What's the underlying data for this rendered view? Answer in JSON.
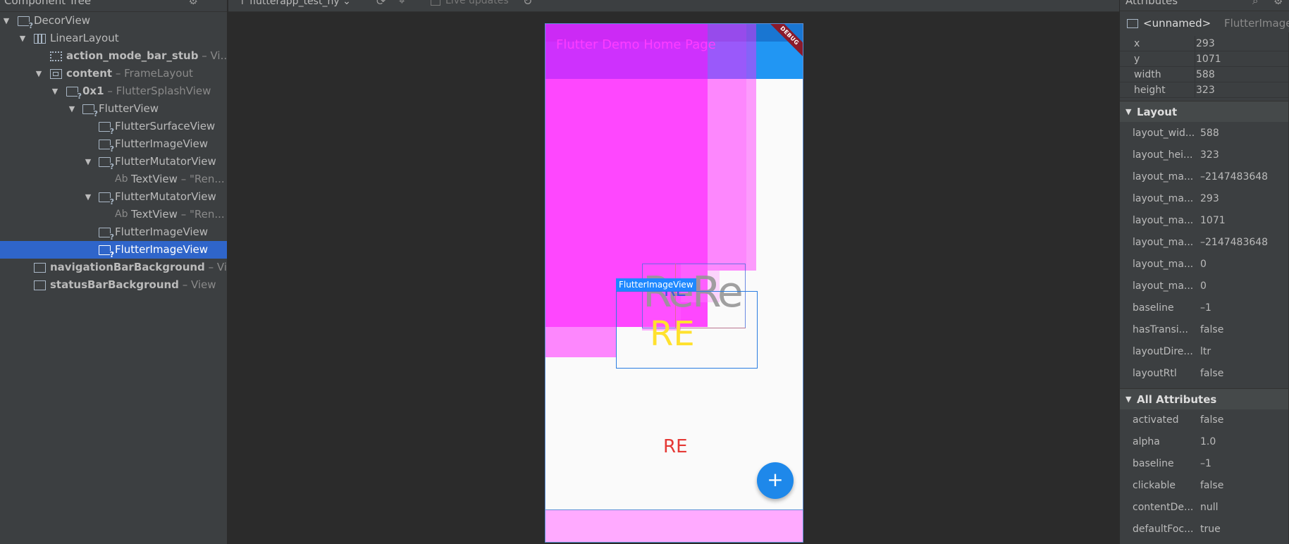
{
  "tree": {
    "title": "Component Tree",
    "gear_icon": "gear-icon",
    "items": [
      {
        "label": "DecorView",
        "bold": "",
        "suffix": ""
      },
      {
        "label": "LinearLayout",
        "bold": "",
        "suffix": ""
      },
      {
        "label": "",
        "bold": "action_mode_bar_stub",
        "suffix": " – Vi..."
      },
      {
        "label": "",
        "bold": "content",
        "suffix": " – FrameLayout"
      },
      {
        "label": "",
        "bold": "0x1",
        "suffix": " – FlutterSplashView"
      },
      {
        "label": "FlutterView",
        "bold": "",
        "suffix": ""
      },
      {
        "label": "FlutterSurfaceView",
        "bold": "",
        "suffix": ""
      },
      {
        "label": "FlutterImageView",
        "bold": "",
        "suffix": ""
      },
      {
        "label": "FlutterMutatorView",
        "bold": "",
        "suffix": ""
      },
      {
        "label": "TextView",
        "bold": "",
        "suffix": " – \"Ren...",
        "ab": "Ab"
      },
      {
        "label": "FlutterMutatorView",
        "bold": "",
        "suffix": ""
      },
      {
        "label": "TextView",
        "bold": "",
        "suffix": " – \"Ren...",
        "ab": "Ab"
      },
      {
        "label": "FlutterImageView",
        "bold": "",
        "suffix": ""
      },
      {
        "label": "FlutterImageView",
        "bold": "",
        "suffix": ""
      },
      {
        "label": "",
        "bold": "navigationBarBackground",
        "suffix": " – Vi..."
      },
      {
        "label": "",
        "bold": "statusBarBackground",
        "suffix": " – View"
      }
    ]
  },
  "toolbar": {
    "process": "↑ flutterapp_test_hy ⌄",
    "live_updates": "Live updates"
  },
  "device": {
    "app_title": "Flutter Demo Home Page",
    "debug_banner": "DEBUG",
    "selection_label": "FlutterImageView",
    "text_re_big": "ReRe",
    "text_re_blue": "RE",
    "text_re_yellow": "RE",
    "text_re_red": "RE",
    "fab_label": "+"
  },
  "canvas_tools": {
    "pan": "✋",
    "zoom_in": "+",
    "zoom_out": "−",
    "fit": "⊡"
  },
  "attributes": {
    "title": "Attributes",
    "view_name": "<unnamed>",
    "view_class": "FlutterImageView",
    "geometry": [
      {
        "key": "x",
        "value": "293"
      },
      {
        "key": "y",
        "value": "1071"
      },
      {
        "key": "width",
        "value": "588"
      },
      {
        "key": "height",
        "value": "323"
      }
    ],
    "layout_section": "Layout",
    "layout": [
      {
        "key": "layout_wid...",
        "value": "588"
      },
      {
        "key": "layout_hei...",
        "value": "323"
      },
      {
        "key": "layout_ma...",
        "value": "–2147483648"
      },
      {
        "key": "layout_ma...",
        "value": "293"
      },
      {
        "key": "layout_ma...",
        "value": "1071"
      },
      {
        "key": "layout_ma...",
        "value": "–2147483648"
      },
      {
        "key": "layout_ma...",
        "value": "0"
      },
      {
        "key": "layout_ma...",
        "value": "0"
      },
      {
        "key": "baseline",
        "value": "–1"
      },
      {
        "key": "hasTransi...",
        "value": "false"
      },
      {
        "key": "layoutDire...",
        "value": "ltr"
      },
      {
        "key": "layoutRtl",
        "value": "false"
      }
    ],
    "all_section": "All Attributes",
    "all": [
      {
        "key": "activated",
        "value": "false"
      },
      {
        "key": "alpha",
        "value": "1.0"
      },
      {
        "key": "baseline",
        "value": "–1"
      },
      {
        "key": "clickable",
        "value": "false"
      },
      {
        "key": "contentDe...",
        "value": "null"
      },
      {
        "key": "defaultFoc...",
        "value": "true"
      }
    ]
  },
  "colors": {
    "selection": "#2f65ca",
    "app_bar": "#2196f3",
    "magenta_overlay": "#ff00ff",
    "fab": "#1e88ea"
  }
}
